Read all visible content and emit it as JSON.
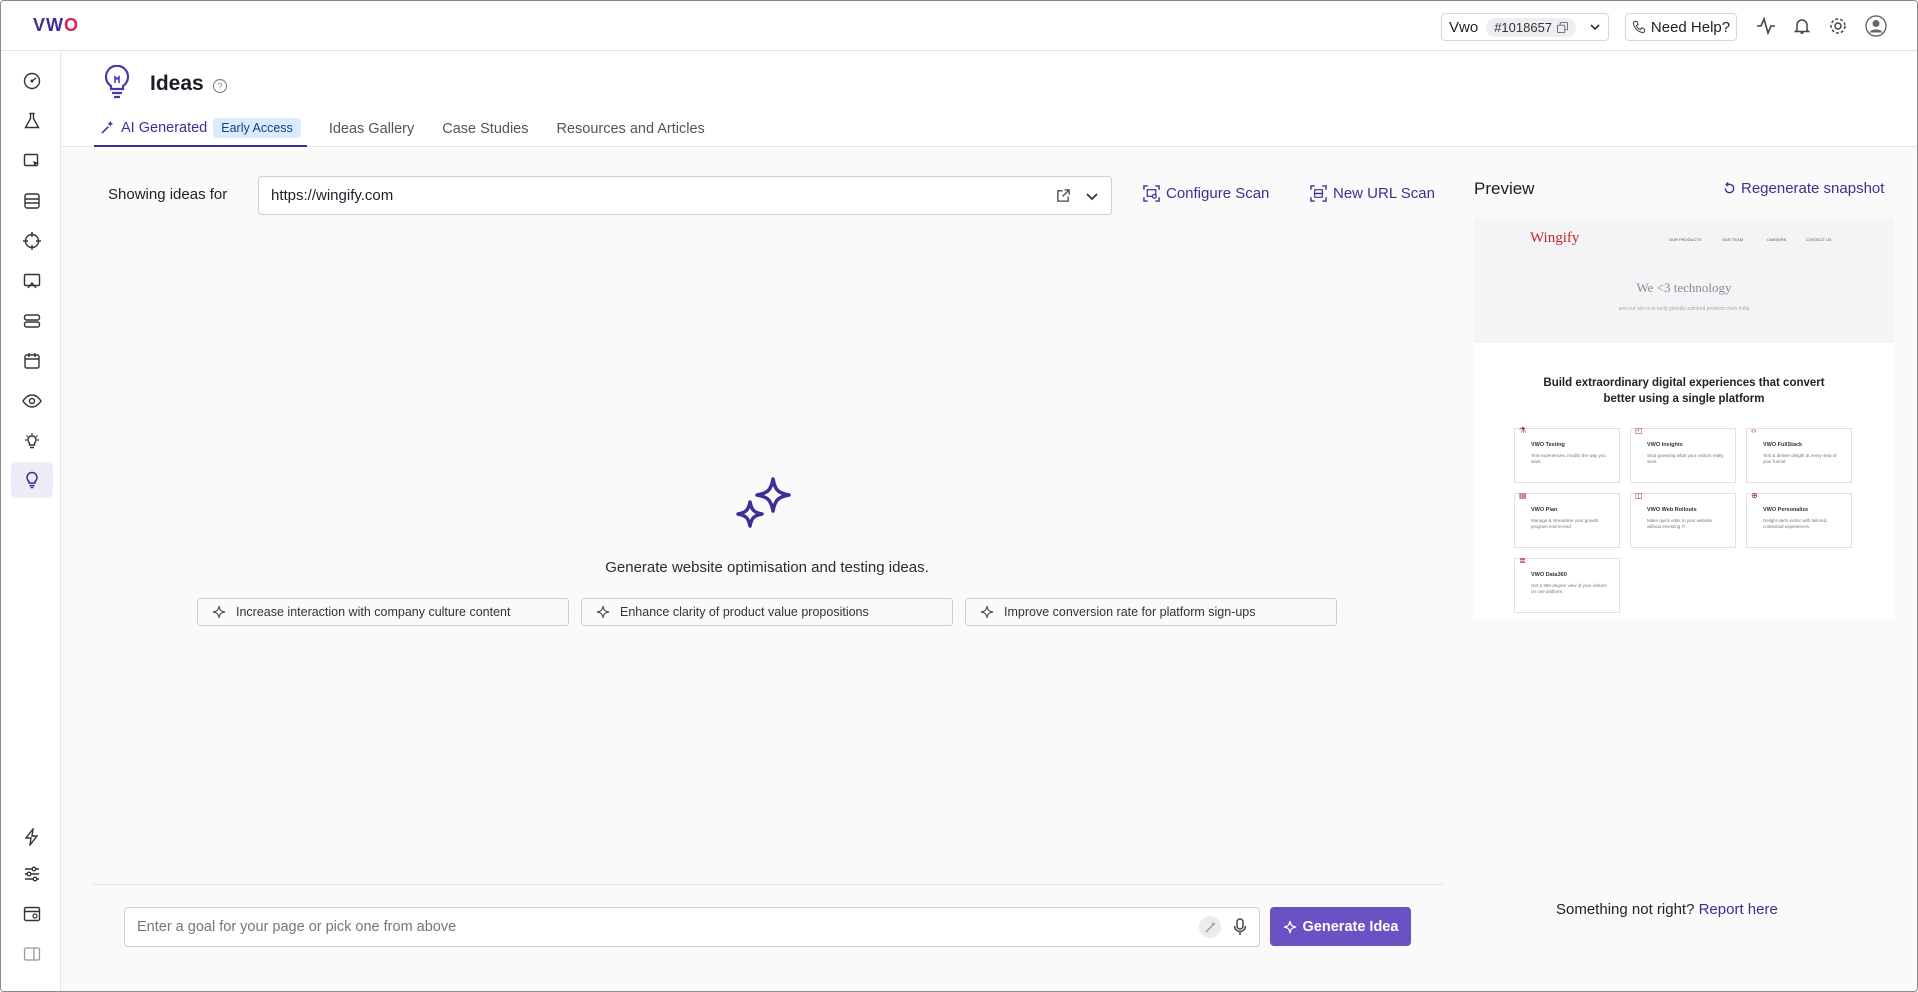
{
  "brand": {
    "logo_text": "VWO",
    "accent": "#3d2f95",
    "brand_red": "#d9224e"
  },
  "topbar": {
    "account_name": "Vwo",
    "account_id": "#1018657",
    "help_label": "Need Help?",
    "icons": [
      "activity-icon",
      "bell-icon",
      "gear-icon",
      "user-icon"
    ]
  },
  "sidebar": {
    "items": [
      "dashboard-icon",
      "flask-icon",
      "pointer-icon",
      "database-icon",
      "target-icon",
      "survey-icon",
      "server-icon",
      "calendar-icon",
      "eye-icon",
      "lightbulb-rays-icon",
      "lightbulb-icon"
    ],
    "bottom_items": [
      "lightning-icon",
      "sliders-icon",
      "browser-card-icon",
      "panel-toggle-icon"
    ],
    "active_index": 10
  },
  "page": {
    "title": "Ideas",
    "tabs": [
      {
        "label": "AI Generated",
        "badge": "Early Access",
        "active": true
      },
      {
        "label": "Ideas Gallery"
      },
      {
        "label": "Case Studies"
      },
      {
        "label": "Resources and Articles"
      }
    ]
  },
  "scan": {
    "showing_label": "Showing ideas for",
    "url": "https://wingify.com",
    "configure_label": "Configure Scan",
    "new_scan_label": "New URL Scan"
  },
  "empty_state": {
    "message": "Generate website optimisation and testing ideas.",
    "suggestions": [
      "Increase interaction with company culture content",
      "Enhance clarity of product value propositions",
      "Improve conversion rate for platform sign-ups"
    ]
  },
  "goal_input": {
    "placeholder": "Enter a goal for your page or pick one from above",
    "button_label": "Generate Idea"
  },
  "preview": {
    "title": "Preview",
    "regenerate_label": "Regenerate snapshot",
    "snapshot": {
      "brand": "Wingify",
      "nav": [
        "OUR PRODUCTS",
        "OUR TEAM",
        "CAREERS",
        "CONTACT US"
      ],
      "hero_title": "We <3 technology",
      "hero_subtitle": "and our aim is to build globally admired products from India",
      "section_title": "Build extraordinary digital experiences that convert better using a single platform",
      "cards": [
        {
          "name": "VWO Testing",
          "desc": "Test experiences, modify the way you want."
        },
        {
          "name": "VWO Insights",
          "desc": "Stop guessing what your visitors really want."
        },
        {
          "name": "VWO FullStack",
          "desc": "Test & deliver delight at every step of your funnel."
        },
        {
          "name": "VWO Plan",
          "desc": "Manage & streamline your growth program end-to-end."
        },
        {
          "name": "VWO Web Rollouts",
          "desc": "Make quick edits to your website without investing IT"
        },
        {
          "name": "VWO Personalize",
          "desc": "Delight each visitor with tailored, contextual experiences."
        },
        {
          "name": "VWO Data360",
          "desc": "Get a 360-degree view of your visitors on one platform."
        }
      ]
    },
    "feedback_text": "Something not right?",
    "feedback_link": "Report here"
  }
}
